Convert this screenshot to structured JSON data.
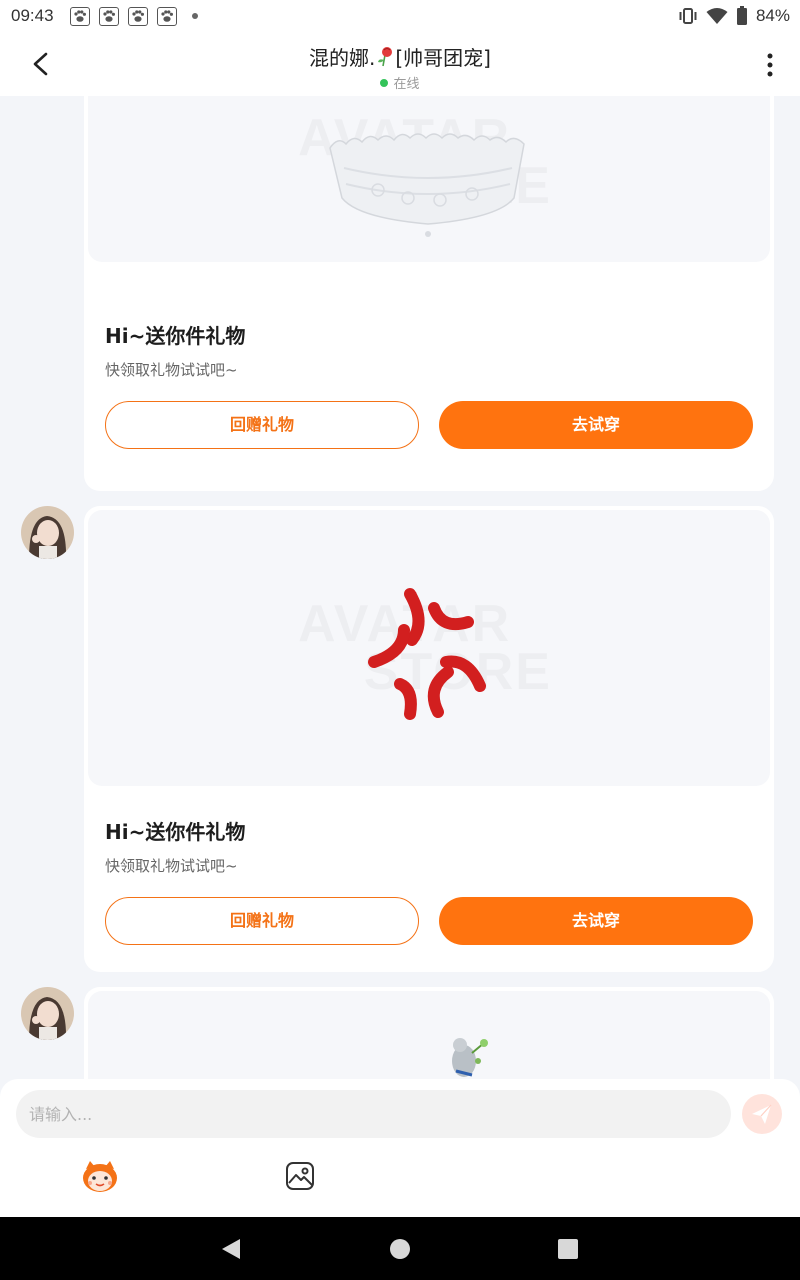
{
  "status_bar": {
    "time": "09:43",
    "battery_text": "84%",
    "notification_icons": [
      "paw-icon",
      "paw-icon",
      "paw-icon",
      "paw-icon"
    ]
  },
  "header": {
    "title": "混的娜.",
    "title_suffix": "[帅哥团宠]",
    "status": "在线"
  },
  "messages": [
    {
      "title": "Hi~送你件礼物",
      "subtitle": "快领取礼物试试吧~",
      "return_gift_label": "回赠礼物",
      "try_on_label": "去试穿",
      "item": "lace-headband"
    },
    {
      "title": "Hi~送你件礼物",
      "subtitle": "快领取礼物试试吧~",
      "return_gift_label": "回赠礼物",
      "try_on_label": "去试穿",
      "item": "angry-mark"
    },
    {
      "item": "flower-figurine"
    }
  ],
  "composer": {
    "placeholder": "请输入..."
  },
  "colors": {
    "accent": "#ff730f",
    "online": "#33c35a",
    "background": "#f3f5f9"
  }
}
